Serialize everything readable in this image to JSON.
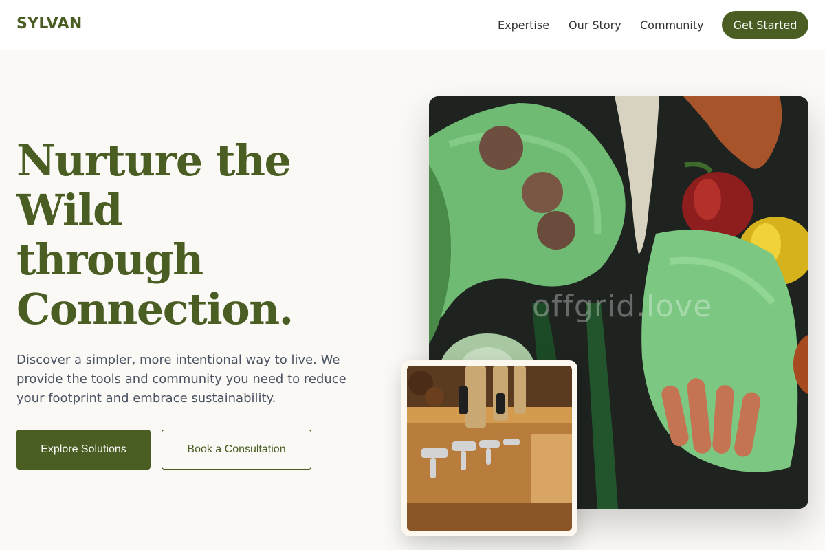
{
  "brand": {
    "name": "SYLVAN"
  },
  "nav": {
    "links": [
      "Expertise",
      "Our Story",
      "Community"
    ],
    "cta_label": "Get Started"
  },
  "hero": {
    "title_lines": [
      "Nurture the",
      "Wild",
      "through",
      "Connection."
    ],
    "description": "Discover a simpler, more intentional way to live. We provide the tools and community you need to reduce your footprint and embrace sustainability.",
    "primary_button": "Explore Solutions",
    "secondary_button": "Book a Consultation"
  },
  "images": {
    "main_watermark": "offgrid.love"
  },
  "colors": {
    "brand": "#4a5d23",
    "background": "#faf9f5",
    "text_muted": "#4b5363"
  }
}
